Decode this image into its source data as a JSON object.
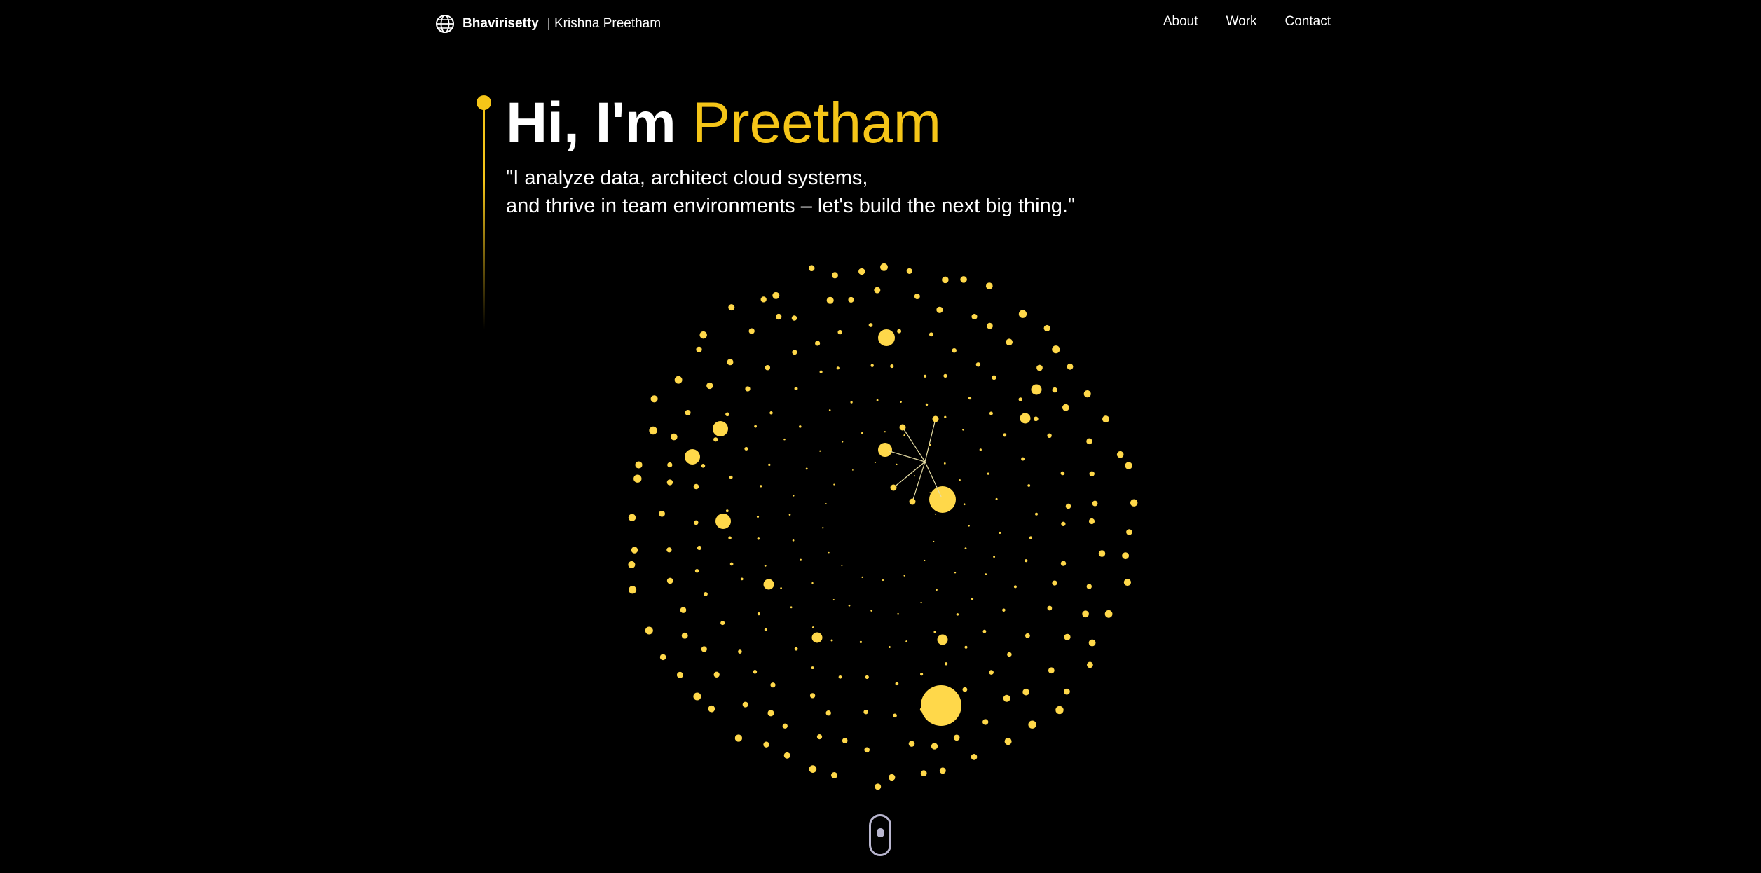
{
  "header": {
    "brand_bold": "Bhavirisetty",
    "brand_sub": "| Krishna Preetham",
    "logo_icon": "globe-icon",
    "nav": [
      {
        "label": "About"
      },
      {
        "label": "Work"
      },
      {
        "label": "Contact"
      }
    ]
  },
  "hero": {
    "greeting": "Hi, I'm ",
    "name": "Preetham",
    "quote_line1": "\"I analyze data, architect cloud systems,",
    "quote_line2": "and thrive in team environments – let's build the next big thing.\""
  },
  "colors": {
    "background": "#000000",
    "accent": "#f5c518",
    "particle": "#ffd84a",
    "scroll_indicator": "#b9b6cf"
  },
  "visual": {
    "sphere_icon": "particle-sphere-icon",
    "scroll_icon": "mouse-scroll-icon"
  }
}
